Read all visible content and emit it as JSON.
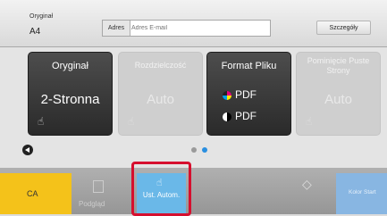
{
  "header": {
    "original_label": "Oryginał",
    "original_size": "A4",
    "address_label": "Adres",
    "address_placeholder": "Adres E-mail",
    "details_button": "Szczegóły"
  },
  "tiles": [
    {
      "title": "Oryginał",
      "value": "2-Stronna",
      "enabled": true
    },
    {
      "title": "Rozdzielczość",
      "value": "Auto",
      "enabled": false
    },
    {
      "title": "Format Pliku",
      "pdf_rows": [
        "PDF",
        "PDF"
      ],
      "enabled": true
    },
    {
      "title": "Pominięcie Puste Strony",
      "value": "Auto",
      "enabled": false
    }
  ],
  "pager": {
    "pages": 2,
    "current": 2
  },
  "bottom": {
    "ca": "CA",
    "preview": "Podgląd",
    "auto_set": "Ust. Autom.",
    "color_start": "Kolor Start"
  },
  "colors": {
    "ca_yellow": "#f4c21a",
    "highlight_red": "#d60f2e",
    "auto_blue": "#6ab8e8",
    "color_start_blue": "#88b6e2"
  }
}
